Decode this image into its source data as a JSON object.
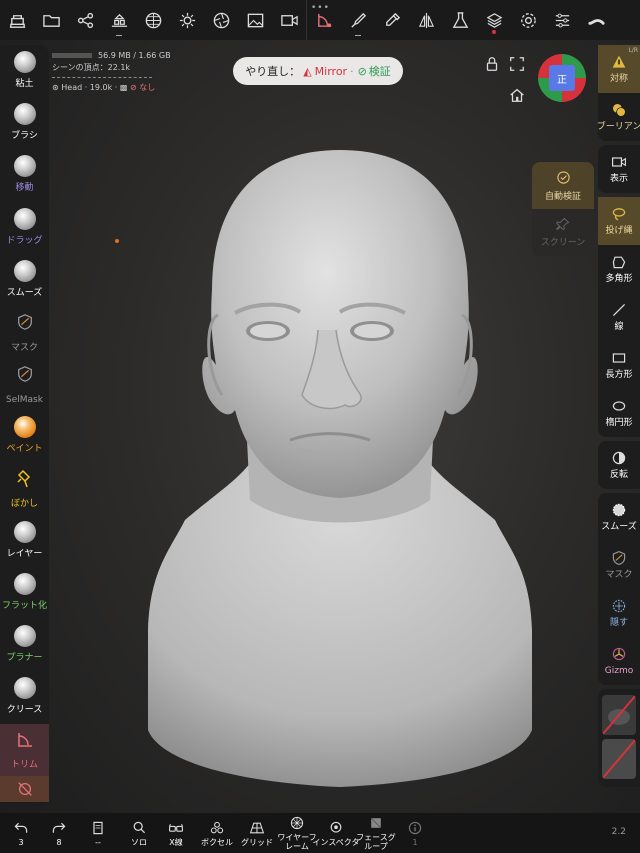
{
  "top_toolbar": {
    "icons": [
      "gallery-icon",
      "folder-icon",
      "share-nodes-icon",
      "stack-icon",
      "grid-sphere-icon",
      "sun-icon",
      "aperture-icon",
      "image-icon",
      "video-icon",
      "trim-tool-icon",
      "brush-icon",
      "picker-icon",
      "symmetry-icon",
      "flask-icon",
      "layers-icon",
      "gear-icon",
      "sliders-icon",
      "paint-stroke-icon"
    ]
  },
  "info": {
    "memory": "56.9 MB / 1.66 GB",
    "vertices": "シーンの頂点：22.1k",
    "mesh_name": "Head",
    "mesh_stats": "· 19.0k ·",
    "mesh_extra": "なし"
  },
  "pill": {
    "prefix": "やり直し：",
    "mirror": "Mirror",
    "separator": "·",
    "verify": "検証"
  },
  "cube": {
    "label": "正"
  },
  "auto_panel": {
    "auto_verify": "自動検証",
    "screen": "スクリーン"
  },
  "left_tools": [
    {
      "label": "粘土",
      "color": "#ffffff"
    },
    {
      "label": "ブラシ",
      "color": "#ffffff"
    },
    {
      "label": "移動",
      "color": "#9b8be0"
    },
    {
      "label": "ドラッグ",
      "color": "#9b8be0"
    },
    {
      "label": "スムーズ",
      "color": "#ffffff"
    },
    {
      "label": "マスク",
      "color": "#9a9a9a"
    },
    {
      "label": "SelMask",
      "color": "#9a9a9a"
    },
    {
      "label": "ペイント",
      "color": "#f0a030"
    },
    {
      "label": "ぼかし",
      "color": "#f0c020"
    },
    {
      "label": "レイヤー",
      "color": "#ffffff"
    },
    {
      "label": "フラット化",
      "color": "#7ed06a"
    },
    {
      "label": "プラナー",
      "color": "#7ed06a"
    },
    {
      "label": "クリース",
      "color": "#ffffff"
    },
    {
      "label": "トリム",
      "color": "#e8707a"
    }
  ],
  "right_tools": {
    "symmetry": {
      "label": "対称",
      "corner": "L/R"
    },
    "boolean": {
      "label": "ブーリアン"
    },
    "display": {
      "label": "表示"
    },
    "lasso": {
      "label": "投げ縄"
    },
    "polygon": {
      "label": "多角形"
    },
    "line": {
      "label": "線"
    },
    "rectangle": {
      "label": "長方形"
    },
    "ellipse": {
      "label": "楕円形"
    },
    "invert": {
      "label": "反転"
    },
    "smooth": {
      "label": "スムーズ"
    },
    "mask": {
      "label": "マスク"
    },
    "hide": {
      "label": "隠す"
    },
    "gizmo": {
      "label": "Gizmo"
    }
  },
  "bottom_bar": {
    "undo": {
      "label": "3"
    },
    "redo": {
      "label": "8"
    },
    "book": {
      "label": "--"
    },
    "solo": {
      "label": "ソロ"
    },
    "xray": {
      "label": "X線"
    },
    "voxel": {
      "label": "ボクセル"
    },
    "grid": {
      "label": "グリッド"
    },
    "wireframe": {
      "label": "ワイヤーフレーム"
    },
    "inspector": {
      "label": "インスペクタ"
    },
    "facegroup": {
      "label": "フェースグループ"
    },
    "info": {
      "label": "1"
    }
  },
  "version": "2.2",
  "colors": {
    "background": "#2c2b2a",
    "toolbar": "#1e1d1d",
    "trim_active": "#4a2f34",
    "right_active": "#574a2a",
    "accent_red": "#d6323c",
    "accent_green": "#2e9b53",
    "model": "#bdbdbd"
  }
}
